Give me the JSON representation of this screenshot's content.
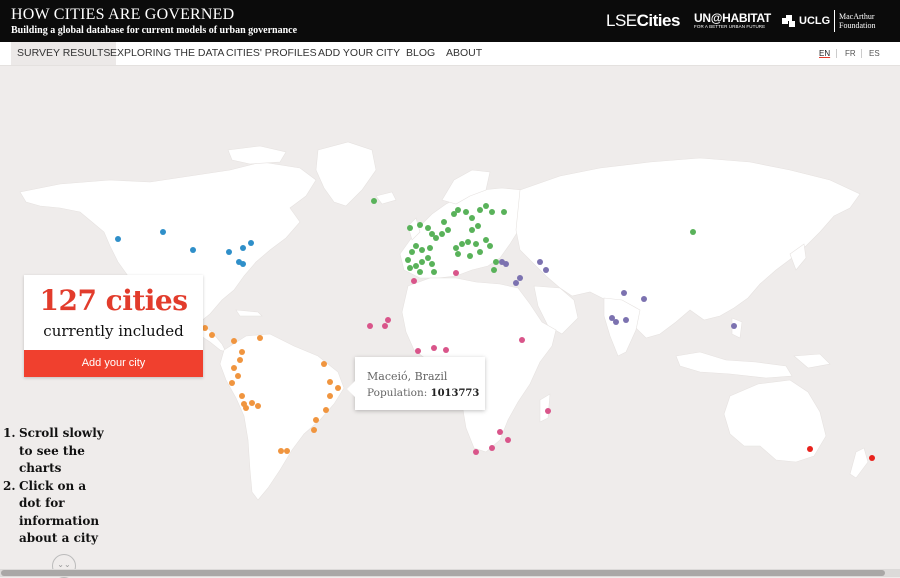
{
  "header": {
    "title": "HOW CITIES ARE GOVERNED",
    "subtitle": "Building a global database for current models of urban governance",
    "logos": {
      "lse_light": "LSE",
      "lse_bold": "Cities",
      "unhabitat": "UN@HABITAT",
      "unhabitat_tagline": "FOR A BETTER URBAN FUTURE",
      "uclg": "UCLG",
      "macarthur_line1": "MacArthur",
      "macarthur_line2": "Foundation"
    }
  },
  "nav": {
    "items": [
      "SURVEY RESULTS",
      "EXPLORING THE DATA",
      "CITIES' PROFILES",
      "ADD YOUR CITY",
      "BLOG",
      "ABOUT"
    ],
    "active_index": 0,
    "languages": [
      "EN",
      "FR",
      "ES"
    ],
    "active_language": "EN"
  },
  "stats": {
    "count": "127 cities",
    "label": "currently included",
    "button": "Add your city"
  },
  "tooltip": {
    "city": "Maceió, Brazil",
    "population_label": "Population:",
    "population_value": "1013773"
  },
  "instructions": {
    "steps": [
      {
        "num": "1.",
        "text": "Scroll slowly to see the charts"
      },
      {
        "num": "2.",
        "text": "Click on a dot for information about a city"
      }
    ]
  },
  "scroll_icon": "double-chevron-down-icon",
  "colors": {
    "accent_red": "#e23c2c",
    "button_red": "#f0402e",
    "north_america": "#2f8fc9",
    "latin_america": "#f0953f",
    "europe": "#59b25a",
    "africa": "#d9558a",
    "asia": "#7c72b0",
    "oceania": "#e8221c",
    "map_land": "#ffffff",
    "map_background": "#efeceb"
  }
}
